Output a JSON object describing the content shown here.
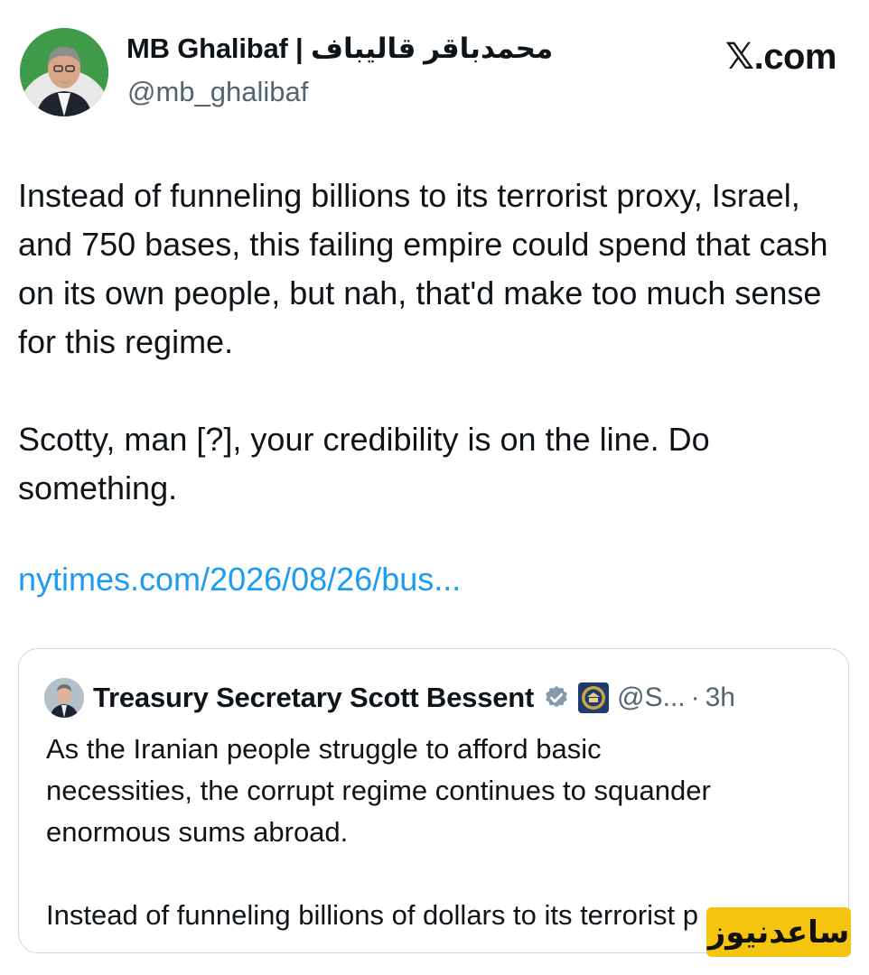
{
  "author": {
    "display_name": "MB Ghalibaf | محمدباقر قالیباف",
    "handle": "@mb_ghalibaf",
    "avatar_icon": "portrait-avatar"
  },
  "brand": "𝕏.com",
  "tweet": {
    "paragraphs": [
      "Instead of funneling billions to its terrorist proxy, Israel, and 750 bases, this failing empire could spend that cash on its own people, but nah, that'd make too much sense for this regime.",
      "Scotty, man [?], your credibility is on the line. Do something."
    ],
    "link": "nytimes.com/2026/08/26/bus..."
  },
  "quote": {
    "display_name": "Treasury Secretary Scott Bessent",
    "handle": "@S...",
    "separator": "·",
    "time": "3h",
    "verified_icon": "gray-verified-badge",
    "seal_icon": "treasury-seal",
    "paragraphs": [
      "As the Iranian people struggle to afford basic necessities, the corrupt regime continues to squander enormous sums abroad.",
      "Instead of funneling billions of dollars to its terrorist p"
    ]
  },
  "watermark": {
    "text": "ساعدنیوز",
    "color": "#f4c40f"
  },
  "colors": {
    "link": "#1d9bf0",
    "secondary_text": "#536471",
    "border": "#cfd9de"
  }
}
